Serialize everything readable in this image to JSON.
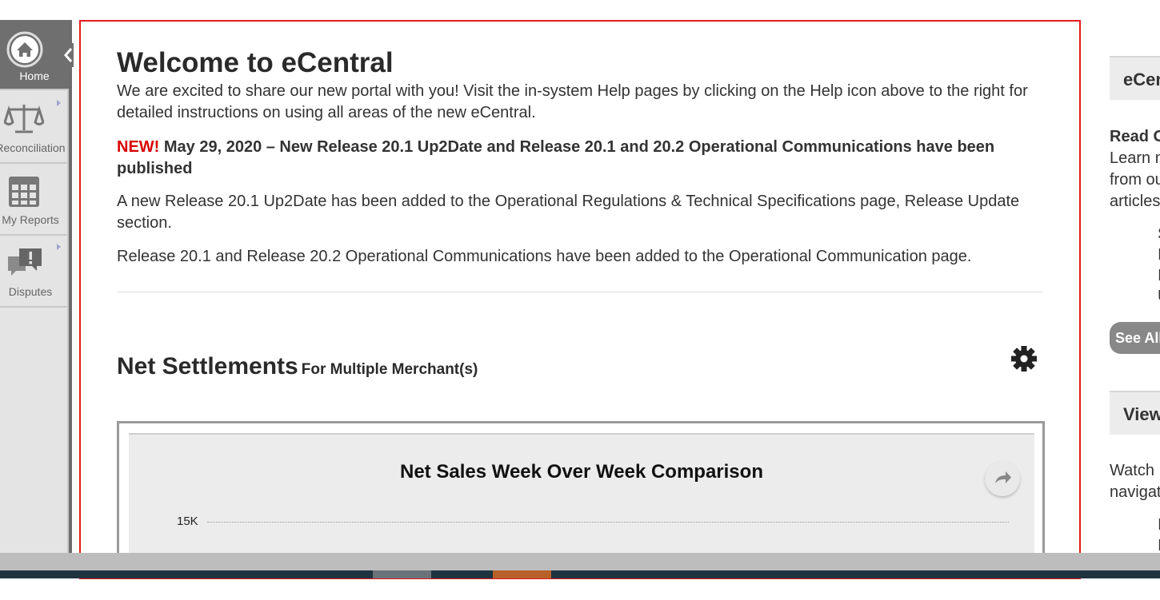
{
  "sidebar": {
    "items": [
      {
        "label": "Home",
        "icon": "home-icon",
        "active": true
      },
      {
        "label": "Reconciliation",
        "icon": "scales-icon"
      },
      {
        "label": "My Reports",
        "icon": "grid-icon"
      },
      {
        "label": "Disputes",
        "icon": "chat-alert-icon"
      }
    ]
  },
  "welcome": {
    "title": "Welcome to eCentral",
    "intro": "We are excited to share our new portal with you!  Visit the in-system Help pages by clicking on the Help icon above to the right for detailed instructions on using all areas of the new eCentral.",
    "news_flag": "NEW!",
    "news_headline": " May 29, 2020 – New Release 20.1 Up2Date and Release 20.1 and 20.2 Operational Communications have been published",
    "news_p1": "A new Release 20.1 Up2Date has been added to the Operational Regulations & Technical Specifications page, Release Update section.",
    "news_p2": "Release 20.1 and Release 20.2 Operational Communications have been added to the Operational Communication page."
  },
  "net_settlements": {
    "title": "Net Settlements",
    "subtitle": "For Multiple Merchant(s)"
  },
  "chart": {
    "title": "Net Sales Week Over Week Comparison",
    "tick_15k": "15K"
  },
  "chart_data": {
    "type": "line",
    "title": "Net Sales Week Over Week Comparison",
    "y_ticks": [
      "15K"
    ],
    "series": []
  },
  "right_panel": {
    "heading1": "eCentral News",
    "read_title": "Read Our",
    "read_lines": [
      "Learn more",
      "from our",
      "articles"
    ],
    "bullets1": [
      "S",
      "I",
      "I",
      "U"
    ],
    "see_all": "See All",
    "heading2": "View",
    "watch_lines": [
      "Watch",
      "navigate"
    ],
    "bullets2": [
      "I",
      "I"
    ]
  },
  "colors": {
    "accent_red": "#d90000",
    "border_red": "#e31c1c",
    "footer": "#1f3440",
    "footer_orange": "#b8602a"
  }
}
